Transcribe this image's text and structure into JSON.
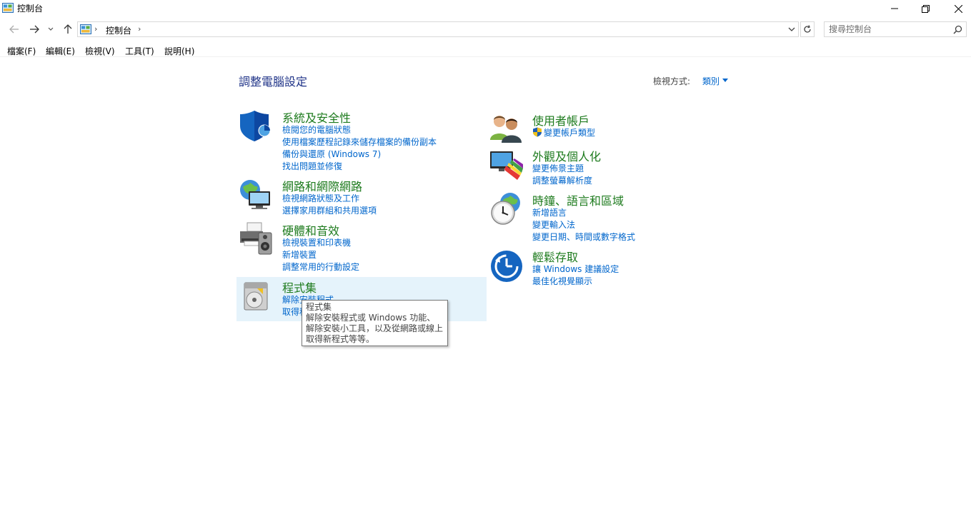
{
  "window": {
    "title": "控制台",
    "controls": {
      "minimize": "—",
      "maximize": "❐",
      "close": "✕"
    }
  },
  "address": {
    "breadcrumb": "控制台",
    "separator": "›",
    "search_placeholder": "搜尋控制台"
  },
  "menu": [
    "檔案(F)",
    "編輯(E)",
    "檢視(V)",
    "工具(T)",
    "說明(H)"
  ],
  "main": {
    "title": "調整電腦設定",
    "view_by_label": "檢視方式:",
    "view_by_value": "類別"
  },
  "categories": {
    "system": {
      "title": "系統及安全性",
      "icon": "shield-icon",
      "links": [
        "檢閱您的電腦狀態",
        "使用檔案歷程記錄來儲存檔案的備份副本",
        "備份與還原 (Windows 7)",
        "找出問題並修復"
      ]
    },
    "network": {
      "title": "網路和網際網路",
      "icon": "network-icon",
      "links": [
        "檢視網路狀態及工作",
        "選擇家用群組和共用選項"
      ]
    },
    "hardware": {
      "title": "硬體和音效",
      "icon": "printer-speaker-icon",
      "links": [
        "檢視裝置和印表機",
        "新增裝置",
        "調整常用的行動設定"
      ]
    },
    "programs": {
      "title": "程式集",
      "icon": "programs-icon",
      "links": [
        "解除安裝程式",
        "取得程式"
      ]
    },
    "users": {
      "title": "使用者帳戶",
      "icon": "users-icon",
      "links": [
        "變更帳戶類型"
      ]
    },
    "appearance": {
      "title": "外觀及個人化",
      "icon": "monitor-palette-icon",
      "links": [
        "變更佈景主題",
        "調整螢幕解析度"
      ]
    },
    "clock": {
      "title": "時鐘、語言和區域",
      "icon": "clock-globe-icon",
      "links": [
        "新增語言",
        "變更輸入法",
        "變更日期、時間或數字格式"
      ]
    },
    "ease": {
      "title": "輕鬆存取",
      "icon": "ease-of-access-icon",
      "links": [
        "讓 Windows 建議設定",
        "最佳化視覺顯示"
      ]
    }
  },
  "tooltip": {
    "title": "程式集",
    "body": "解除安裝程式或 Windows 功能、解除安裝小工具，以及從網路或線上取得新程式等等。"
  },
  "colors": {
    "category_title": "#1e7b1e",
    "link": "#0066cc",
    "page_title": "#1e3287",
    "highlight": "#e5f3fb"
  }
}
